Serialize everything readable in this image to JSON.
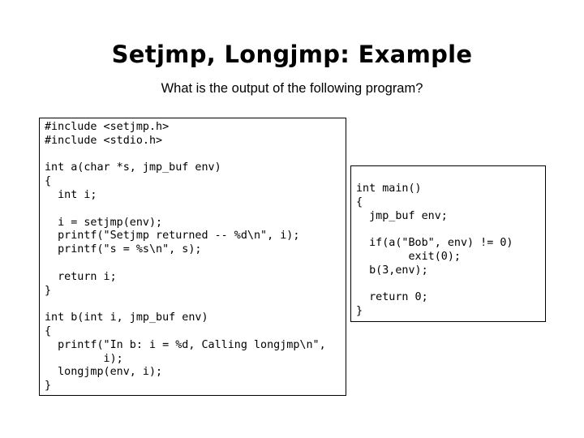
{
  "slide": {
    "title": "Setjmp, Longjmp: Example",
    "subtitle": "What is the output of the following program?"
  },
  "code_left": {
    "lines": [
      "#include <setjmp.h>",
      "#include <stdio.h>",
      "",
      "int a(char *s, jmp_buf env)",
      "{",
      "  int i;",
      "",
      "  i = setjmp(env);",
      "  printf(\"Setjmp returned -- %d\\n\", i);",
      "  printf(\"s = %s\\n\", s);",
      "",
      "  return i;",
      "}",
      "",
      "int b(int i, jmp_buf env)",
      "{",
      "  printf(\"In b: i = %d, Calling longjmp\\n\",",
      "         i);",
      "  longjmp(env, i);",
      "}"
    ]
  },
  "code_right": {
    "lines": [
      "int main()",
      "{",
      "  jmp_buf env;",
      "",
      "  if(a(\"Bob\", env) != 0)",
      "        exit(0);",
      "  b(3,env);",
      "",
      "  return 0;",
      "}"
    ]
  }
}
